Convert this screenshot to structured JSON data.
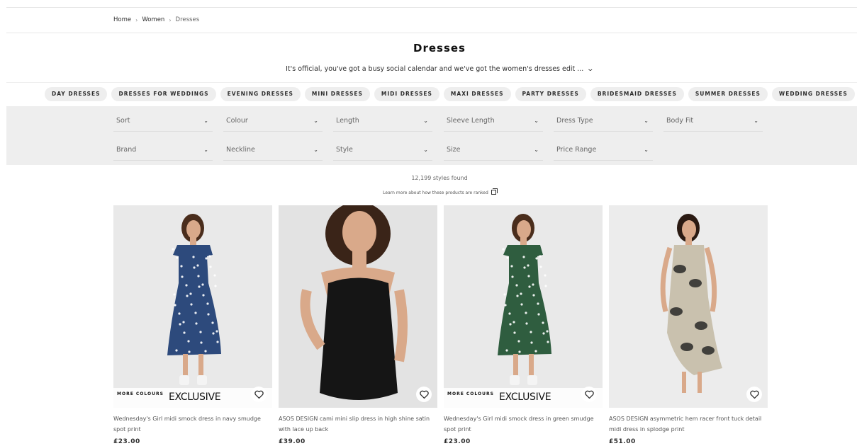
{
  "breadcrumb": {
    "home": "Home",
    "women": "Women",
    "current": "Dresses",
    "separator": "›"
  },
  "page": {
    "title": "Dresses",
    "intro": "It's official, you've got a busy social calendar and we've got the women's dresses edit ...",
    "intro_chevron": "⌄"
  },
  "categories": [
    "DAY DRESSES",
    "DRESSES FOR WEDDINGS",
    "EVENING DRESSES",
    "MINI DRESSES",
    "MIDI DRESSES",
    "MAXI DRESSES",
    "PARTY DRESSES",
    "BRIDESMAID DRESSES",
    "SUMMER DRESSES",
    "WEDDING DRESSES"
  ],
  "filters": {
    "row1": [
      "Sort",
      "Colour",
      "Length",
      "Sleeve Length",
      "Dress Type",
      "Body Fit"
    ],
    "row2": [
      "Brand",
      "Neckline",
      "Style",
      "Size",
      "Price Range"
    ]
  },
  "results": {
    "count": "12,199 styles found",
    "rank_link": "Learn more about how these products are ranked"
  },
  "products": [
    {
      "title": "Wednesday's Girl midi smock dress in navy smudge spot print",
      "price": "£23.00",
      "more_colours": "MORE COLOURS",
      "exclusive": "EXCLUSIVE",
      "dress_color": "#2d4a7c",
      "bg_color": "#e9e9e9"
    },
    {
      "title": "ASOS DESIGN cami mini slip dress in high shine satin with lace up back",
      "price": "£39.00",
      "more_colours": "",
      "exclusive": "",
      "dress_color": "#151515",
      "bg_color": "#e3e3e3"
    },
    {
      "title": "Wednesday's Girl midi smock dress in green smudge spot print",
      "price": "£23.00",
      "more_colours": "MORE COLOURS",
      "exclusive": "EXCLUSIVE",
      "dress_color": "#2f5d3f",
      "bg_color": "#e9e9e9"
    },
    {
      "title": "ASOS DESIGN asymmetric hem racer front tuck detail midi dress in splodge print",
      "price": "£51.00",
      "more_colours": "",
      "exclusive": "",
      "dress_color": "#c9c1ae",
      "bg_color": "#ececec"
    }
  ]
}
